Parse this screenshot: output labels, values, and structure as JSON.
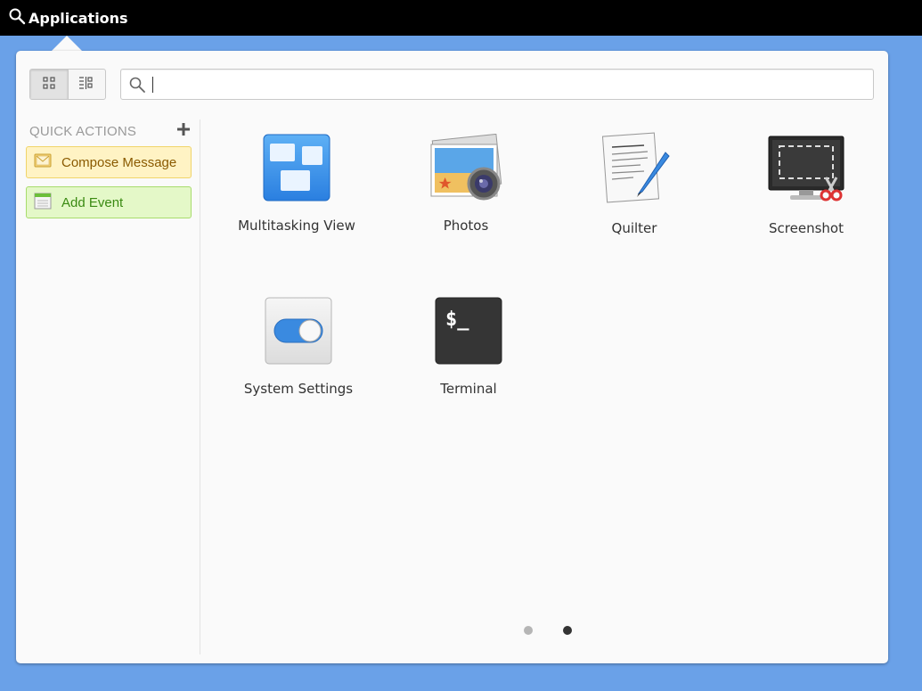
{
  "panel": {
    "title": "Applications",
    "icon": "search-icon"
  },
  "search": {
    "value": "",
    "placeholder": ""
  },
  "view_toggle": {
    "active": "grid",
    "options": [
      "grid-view-icon",
      "category-view-icon"
    ]
  },
  "quick_actions": {
    "title": "QUICK ACTIONS",
    "add_icon": "plus-icon",
    "items": [
      {
        "label": "Compose Message",
        "icon": "mail-icon",
        "color": "#fff3c4"
      },
      {
        "label": "Add Event",
        "icon": "calendar-icon",
        "color": "#e4f8c8"
      }
    ]
  },
  "apps": [
    {
      "label": "Multitasking View",
      "icon": "multitasking-view-icon"
    },
    {
      "label": "Photos",
      "icon": "photos-icon"
    },
    {
      "label": "Quilter",
      "icon": "quilter-icon"
    },
    {
      "label": "Screenshot",
      "icon": "screenshot-icon"
    },
    {
      "label": "System Settings",
      "icon": "system-settings-icon"
    },
    {
      "label": "Terminal",
      "icon": "terminal-icon"
    }
  ],
  "pager": {
    "pages": 2,
    "current": 2
  },
  "colors": {
    "desktop": "#6aa1e8",
    "panel": "#000000",
    "popover": "#fafafa"
  }
}
